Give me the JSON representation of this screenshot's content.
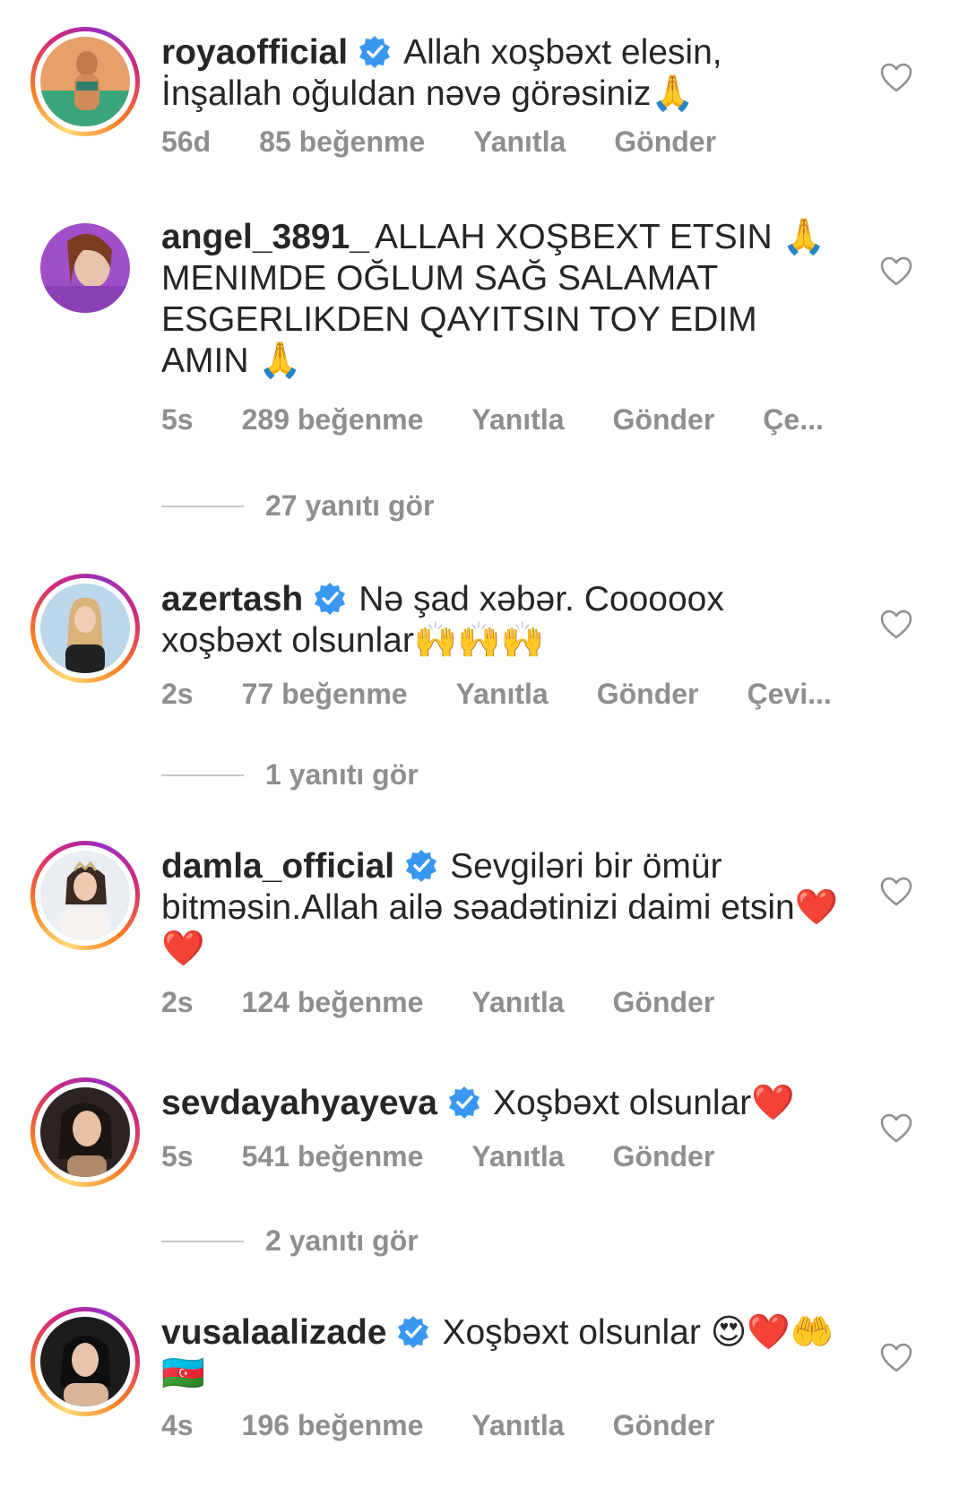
{
  "comments": [
    {
      "username": "royaofficial",
      "verified": true,
      "text": "Allah xoşbəxt elesin, İnşallah oğuldan nəvə görəsiniz🙏",
      "time": "56d",
      "likes": "85 beğenme",
      "reply_label": "Yanıtla",
      "send_label": "Gönder"
    },
    {
      "username": "angel_3891_",
      "verified": false,
      "text": "ALLAH XOŞBEXT ETSIN 🙏 MENIMDE OĞLUM SAĞ SALAMAT ESGERLIKDEN QAYITSIN TOY EDIM AMIN 🙏",
      "time": "5s",
      "likes": "289 beğenme",
      "reply_label": "Yanıtla",
      "send_label": "Gönder",
      "translate_label": "Çe...",
      "view_replies": "27 yanıtı gör"
    },
    {
      "username": "azertash",
      "verified": true,
      "text": "Nə şad xəbər. Cooooox xoşbəxt olsunlar🙌🙌🙌",
      "time": "2s",
      "likes": "77 beğenme",
      "reply_label": "Yanıtla",
      "send_label": "Gönder",
      "translate_label": "Çevi...",
      "view_replies": "1 yanıtı gör"
    },
    {
      "username": "damla_official",
      "verified": true,
      "text": "Sevgiləri bir ömür bitməsin.Allah ailə səadətinizi daimi etsin❤️ ❤️",
      "time": "2s",
      "likes": "124 beğenme",
      "reply_label": "Yanıtla",
      "send_label": "Gönder"
    },
    {
      "username": "sevdayahyayeva",
      "verified": true,
      "text": "Xoşbəxt olsunlar❤️",
      "time": "5s",
      "likes": "541 beğenme",
      "reply_label": "Yanıtla",
      "send_label": "Gönder",
      "view_replies": "2 yanıtı gör"
    },
    {
      "username": "vusalaalizade",
      "verified": true,
      "text": "Xoşbəxt olsunlar 😍❤️🤲 🇦🇿",
      "time": "4s",
      "likes": "196 beğenme",
      "reply_label": "Yanıtla",
      "send_label": "Gönder"
    }
  ],
  "colors": {
    "verified_blue": "#3897f0",
    "meta_gray": "#8e8e8e",
    "text": "#262626"
  },
  "icons": [
    "verified-badge-icon",
    "heart-outline-icon"
  ]
}
